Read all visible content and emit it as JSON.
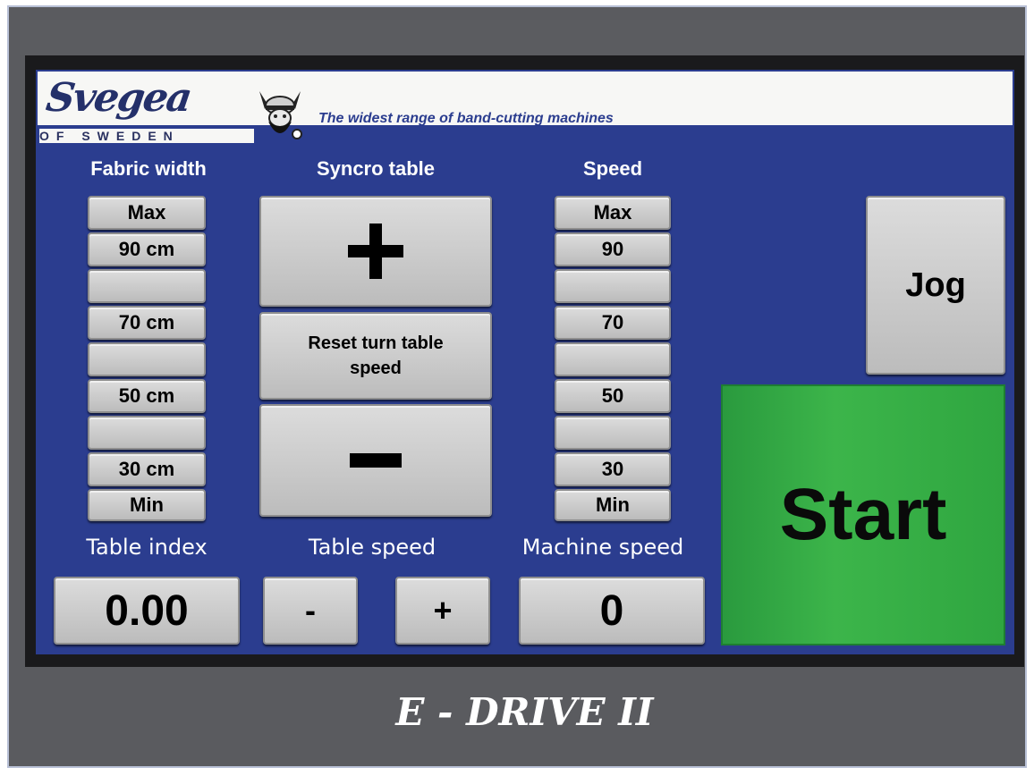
{
  "brand": {
    "logo": "Svegea",
    "logo_sub": "OF SWEDEN",
    "tagline": "The widest range of band-cutting machines"
  },
  "headers": {
    "fabric_width": "Fabric width",
    "syncro_table": "Syncro table",
    "speed": "Speed"
  },
  "fabric_width": {
    "levels": [
      "Max",
      "90 cm",
      "",
      "70 cm",
      "",
      "50 cm",
      "",
      "30 cm",
      "Min"
    ]
  },
  "speed": {
    "levels": [
      "Max",
      "90",
      "",
      "70",
      "",
      "50",
      "",
      "30",
      "Min"
    ]
  },
  "syncro": {
    "plus": "+",
    "reset": "Reset turn table speed",
    "minus": "−"
  },
  "jog": "Jog",
  "start": "Start",
  "bottom": {
    "table_index_label": "Table index",
    "table_index_value": "0.00",
    "table_speed_label": "Table speed",
    "table_speed_minus": "-",
    "table_speed_plus": "+",
    "machine_speed_label": "Machine speed",
    "machine_speed_value": "0"
  },
  "model": "E - DRIVE II",
  "colors": {
    "screen_bg": "#2b3d8f",
    "start_green": "#3cb54a",
    "button_gray": "#c8c8c8",
    "bezel": "#5a5b5f"
  }
}
